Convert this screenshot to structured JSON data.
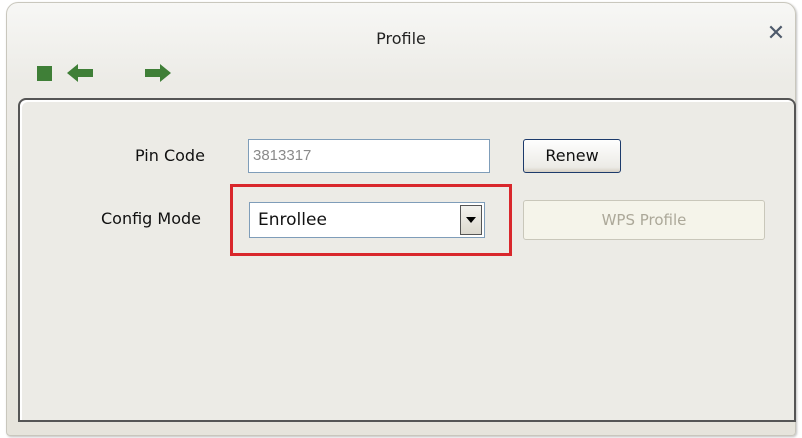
{
  "window": {
    "title": "Profile"
  },
  "toolbar": {
    "icons": [
      "stop-icon",
      "back-arrow-icon",
      "forward-arrow-icon"
    ],
    "icon_color": "#3f7f37"
  },
  "form": {
    "pin_code_label": "Pin Code",
    "pin_code_value": "3813317",
    "renew_label": "Renew",
    "config_mode_label": "Config Mode",
    "config_mode_selected": "Enrollee",
    "wps_profile_label": "WPS Profile"
  },
  "annotation": {
    "highlight_color": "#d9272c"
  }
}
